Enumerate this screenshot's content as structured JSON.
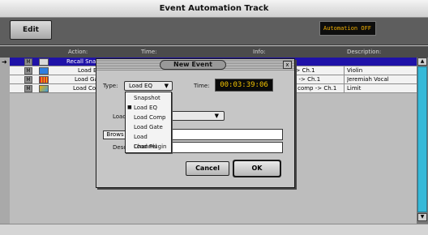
{
  "window": {
    "title": "Event Automation Track"
  },
  "toolbar": {
    "edit_label": "Edit",
    "automation_status": "Automation OFF"
  },
  "columns": {
    "action": "Action:",
    "time": "Time:",
    "info": "Info:",
    "description": "Description:"
  },
  "rows": [
    {
      "m": "M",
      "action": "Recall Sna",
      "info": "",
      "description": "",
      "selected": true,
      "icon": "recall-snapshot-icon"
    },
    {
      "m": "M",
      "action": "Load E",
      "info": "-> Ch.1",
      "description": "Violin",
      "selected": false,
      "icon": "load-eq-icon"
    },
    {
      "m": "M",
      "action": "Load Ga",
      "info": "e -> Ch.1",
      "description": "Jeremiah Vocal",
      "selected": false,
      "icon": "load-gate-icon"
    },
    {
      "m": "M",
      "action": "Load Co",
      "info": "r comp -> Ch.1",
      "description": "Limit",
      "selected": false,
      "icon": "load-comp-icon"
    }
  ],
  "dialog": {
    "title": "New Event",
    "close": "x",
    "type_label": "Type:",
    "type_value": "Load EQ",
    "time_label": "Time:",
    "time_value": "00:03:39:06",
    "load_label": "Load",
    "browse_label": "Brows",
    "desc_label": "Desc",
    "cancel_label": "Cancel",
    "ok_label": "OK"
  },
  "type_menu": {
    "items": [
      {
        "label": "Snapshot",
        "checked": false
      },
      {
        "label": "Load EQ",
        "checked": true
      },
      {
        "label": "Load Comp",
        "checked": false
      },
      {
        "label": "Load Gate",
        "checked": false
      },
      {
        "label": "Load Channel",
        "checked": false
      },
      {
        "label": "Load Plugin",
        "checked": false
      }
    ]
  },
  "icons": {
    "selection_arrow": "➜",
    "caret": "▼",
    "scroll_up": "▲",
    "scroll_down": "▼",
    "bullet": "■"
  },
  "colors": {
    "selection": "#1f12a8",
    "time_text": "#f2c200",
    "automation_text": "#f2b000",
    "scroll_thumb": "#36b9d8"
  }
}
